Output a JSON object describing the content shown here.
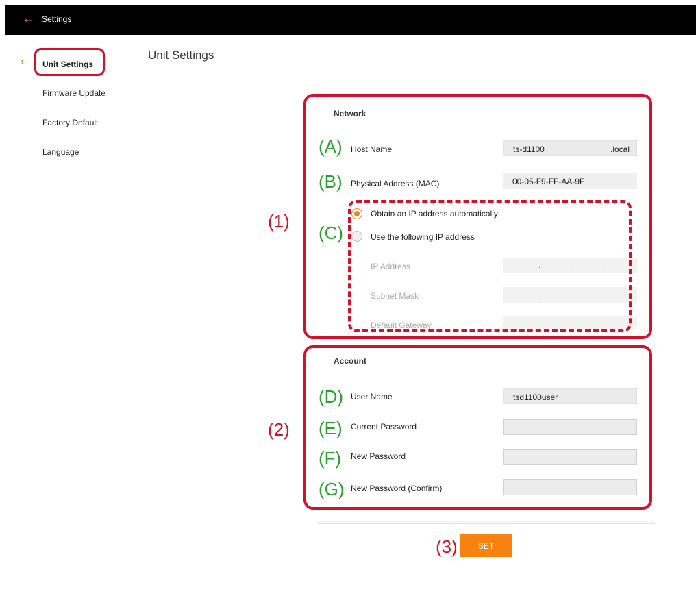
{
  "header": {
    "back_icon": "arrow-left-icon",
    "title": "Settings"
  },
  "sidebar": {
    "items": [
      {
        "label": "Unit Settings",
        "active": true
      },
      {
        "label": "Firmware Update"
      },
      {
        "label": "Factory Default"
      },
      {
        "label": "Language"
      }
    ]
  },
  "main": {
    "title": "Unit Settings"
  },
  "network": {
    "heading": "Network",
    "host_name_label": "Host Name",
    "host_name_value": "ts-d1100",
    "host_name_suffix": ".local",
    "mac_label": "Physical Address (MAC)",
    "mac_value": "00-05-F9-FF-AA-9F",
    "radio_auto_label": "Obtain an IP address automatically",
    "radio_manual_label": "Use the following IP address",
    "ip_label": "IP Address",
    "subnet_label": "Subnet Mask",
    "gateway_label": "Default Gateway"
  },
  "account": {
    "heading": "Account",
    "user_label": "User Name",
    "user_value": "tsd1100user",
    "current_pw_label": "Current Password",
    "new_pw_label": "New Password",
    "confirm_pw_label": "New Password (Confirm)"
  },
  "annotations": {
    "A": "(A)",
    "B": "(B)",
    "C": "(C)",
    "D": "(D)",
    "E": "(E)",
    "F": "(F)",
    "G": "(G)",
    "n1": "(1)",
    "n2": "(2)",
    "n3": "(3)"
  },
  "actions": {
    "set_label": "SET"
  },
  "colors": {
    "accent": "#f7820f",
    "annotation_red": "#d4112a",
    "annotation_green": "#2aa12c",
    "header_bg": "#000000"
  }
}
